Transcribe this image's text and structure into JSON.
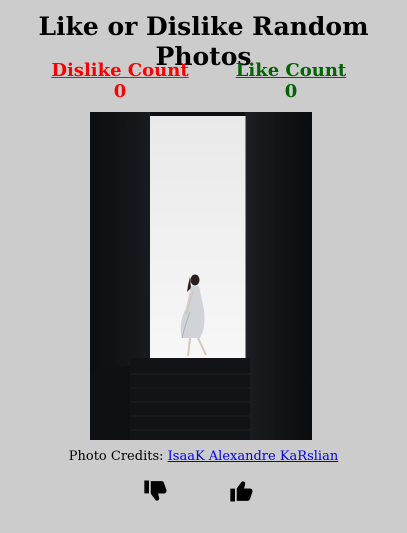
{
  "page": {
    "title": "Like or Dislike Random Photos"
  },
  "counters": {
    "dislike_label": "Dislike Count",
    "dislike_value": "0",
    "like_label": "Like Count",
    "like_value": "0",
    "dislike_color": "#ff0000",
    "like_color": "#006400"
  },
  "photo": {
    "description_icon": "photo-of-person-walking-in-corridor"
  },
  "credits": {
    "prefix": "Photo Credits: ",
    "author": "IsaaK Alexandre KaRslian"
  },
  "actions": {
    "dislike_icon": "thumbs-down-icon",
    "like_icon": "thumbs-up-icon"
  },
  "colors": {
    "background": "#cccccc",
    "link": "#0000ee"
  }
}
